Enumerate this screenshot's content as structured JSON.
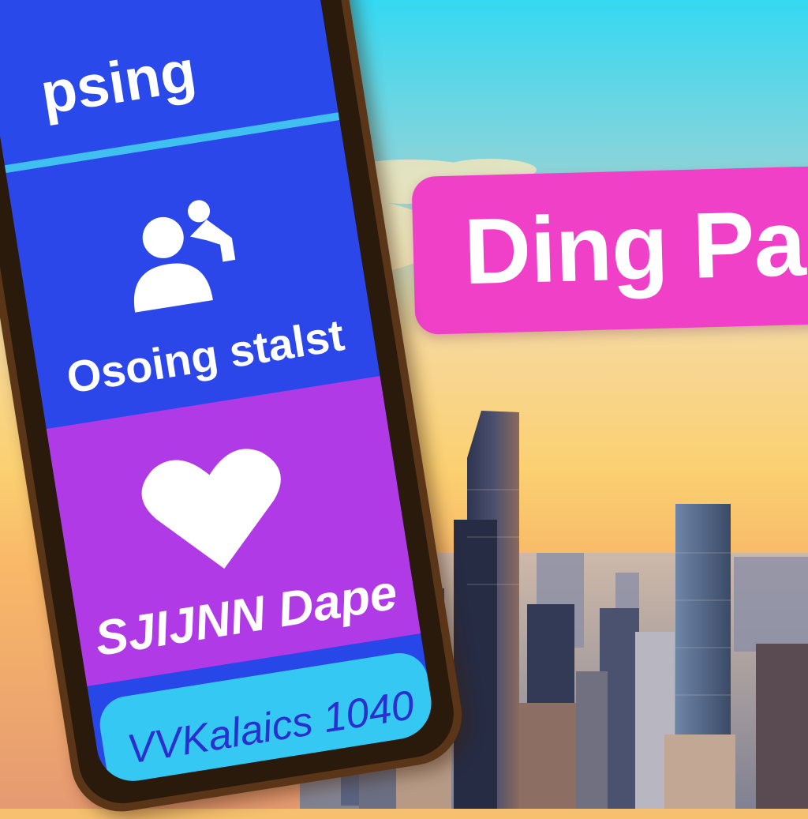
{
  "phone": {
    "header_title": "psing",
    "status_label": "Osoing stalst",
    "match_label": "SJIJNN Dape",
    "cta_label": "VVKalaics 1040"
  },
  "banner": {
    "text": "Ding Pa"
  },
  "icons": {
    "user": "user-icon",
    "heart": "heart-icon"
  },
  "colors": {
    "phone_screen": "#2747e8",
    "match_panel": "#b03ae6",
    "cta_button": "#35c8f2",
    "banner": "#f040c8",
    "sky_top": "#3ad8f0",
    "sky_bottom": "#f8b060"
  }
}
